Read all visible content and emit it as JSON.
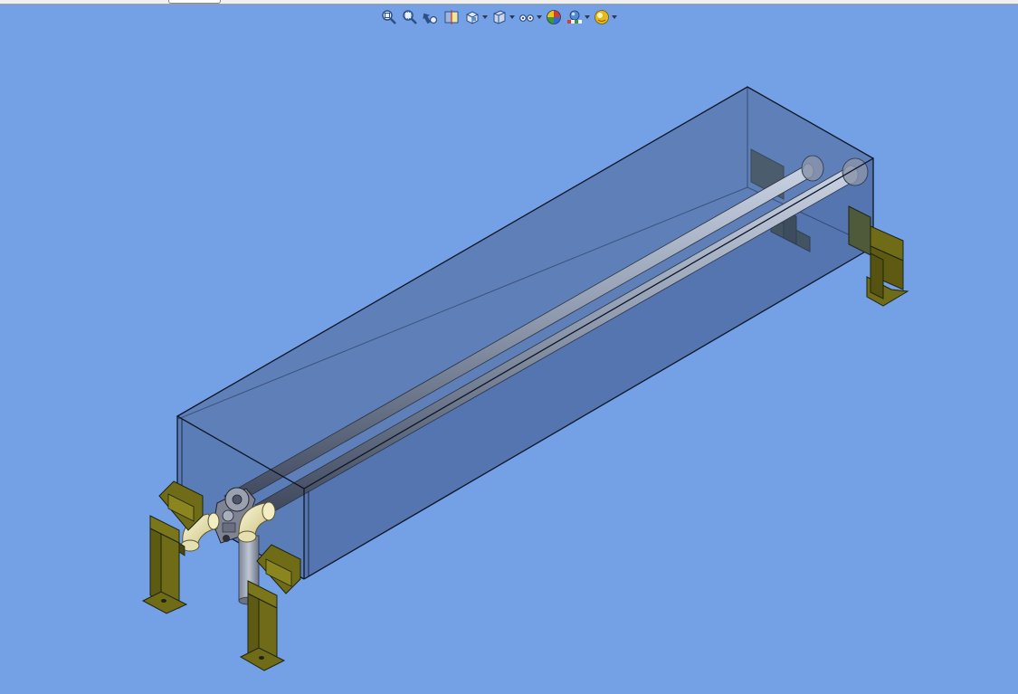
{
  "app": {
    "type": "cad-3d-viewport"
  },
  "theme": {
    "background": "#74a0e5",
    "tank_fill": "#3d4f78",
    "tank_edge": "#0d1626",
    "pipe": "#8d98ae",
    "bracket": "#6f6b16",
    "elbow": "#e2dcb0"
  },
  "toolbar": {
    "buttons": [
      {
        "name": "zoom-to-fit",
        "icon": "zoom-fit-icon",
        "has_dropdown": false
      },
      {
        "name": "zoom-to-area",
        "icon": "zoom-area-icon",
        "has_dropdown": false
      },
      {
        "name": "previous-view",
        "icon": "previous-view-icon",
        "has_dropdown": false
      },
      {
        "name": "section-view",
        "icon": "section-view-icon",
        "has_dropdown": false
      },
      {
        "name": "view-orientation",
        "icon": "view-orientation-icon",
        "has_dropdown": true
      },
      {
        "name": "display-style",
        "icon": "display-style-icon",
        "has_dropdown": true
      },
      {
        "name": "hide-show-items",
        "icon": "hide-show-items-icon",
        "has_dropdown": true
      },
      {
        "name": "edit-appearance",
        "icon": "edit-appearance-icon",
        "has_dropdown": false
      },
      {
        "name": "apply-scene",
        "icon": "apply-scene-icon",
        "has_dropdown": true
      },
      {
        "name": "view-settings",
        "icon": "view-settings-icon",
        "has_dropdown": true
      }
    ]
  }
}
